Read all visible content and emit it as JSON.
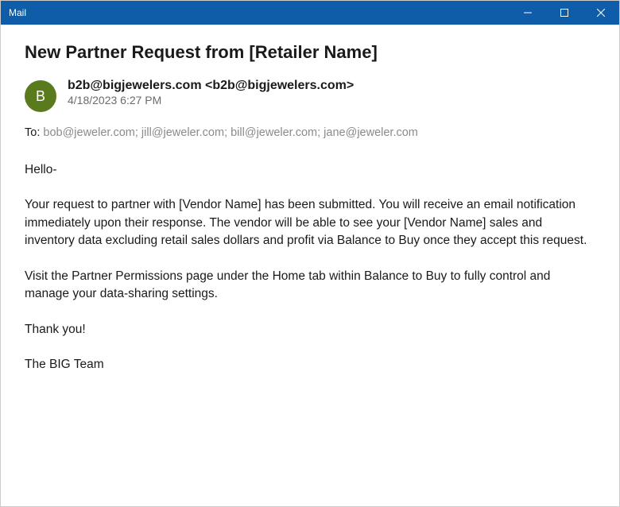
{
  "window": {
    "title": "Mail"
  },
  "email": {
    "subject": "New Partner Request from [Retailer Name]",
    "sender": {
      "initial": "B",
      "display": "b2b@bigjewelers.com <b2b@bigjewelers.com>",
      "timestamp": "4/18/2023 6:27 PM"
    },
    "recipients": {
      "toLabel": "To: ",
      "toList": "bob@jeweler.com; jill@jeweler.com; bill@jeweler.com; jane@jeweler.com"
    },
    "body": {
      "greeting": "Hello-",
      "p1": "Your request to partner with [Vendor Name] has been submitted.  You will receive an email notification immediately upon their response.  The vendor will be able to see your [Vendor Name] sales and inventory data excluding retail sales dollars and profit via Balance to Buy once they accept this request.",
      "p2": "Visit the Partner Permissions page under the Home tab within Balance to Buy to fully control and manage your data-sharing settings.",
      "p3": "Thank you!",
      "signoff": "The BIG Team"
    }
  }
}
